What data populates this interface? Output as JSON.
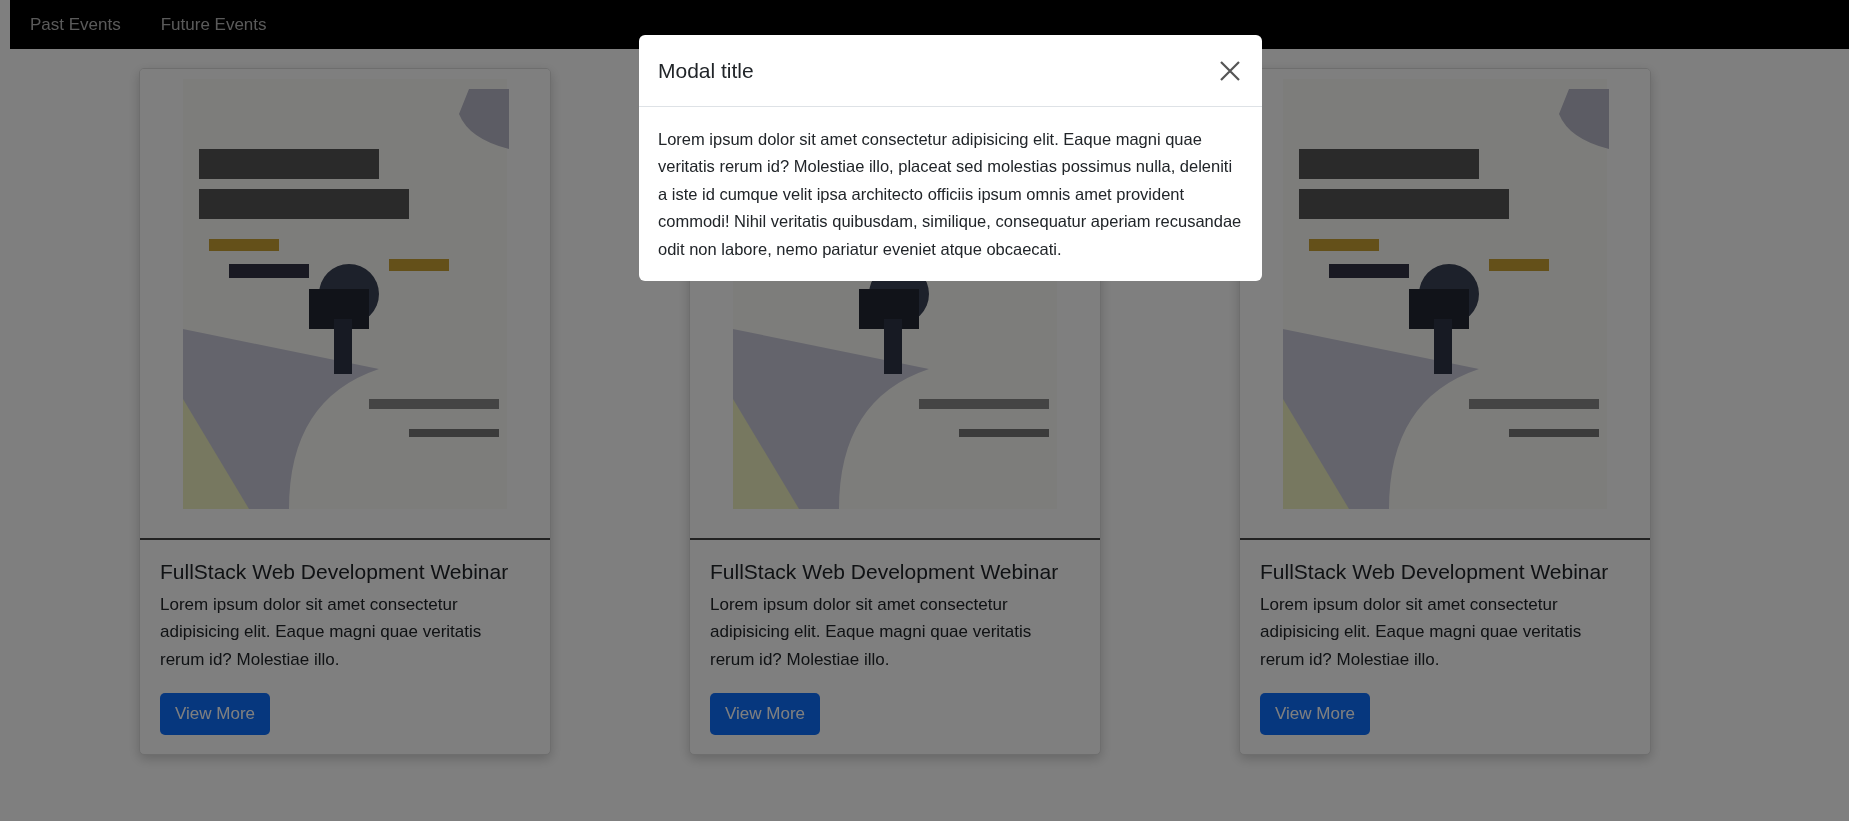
{
  "navbar": {
    "items": [
      {
        "label": "Past Events"
      },
      {
        "label": "Future Events"
      }
    ]
  },
  "cards": [
    {
      "title": "FullStack Web Development Webinar",
      "text": "Lorem ipsum dolor sit amet consectetur adipisicing elit. Eaque magni quae veritatis rerum id? Molestiae illo.",
      "button": "View More"
    },
    {
      "title": "FullStack Web Development Webinar",
      "text": "Lorem ipsum dolor sit amet consectetur adipisicing elit. Eaque magni quae veritatis rerum id? Molestiae illo.",
      "button": "View More"
    },
    {
      "title": "FullStack Web Development Webinar",
      "text": "Lorem ipsum dolor sit amet consectetur adipisicing elit. Eaque magni quae veritatis rerum id? Molestiae illo.",
      "button": "View More"
    }
  ],
  "modal": {
    "title": "Modal title",
    "body": "Lorem ipsum dolor sit amet consectetur adipisicing elit. Eaque magni quae veritatis rerum id? Molestiae illo, placeat sed molestias possimus nulla, deleniti a iste id cumque velit ipsa architecto officiis ipsum omnis amet provident commodi! Nihil veritatis quibusdam, similique, consequatur aperiam recusandae odit non labore, nemo pariatur eveniet atque obcaecati."
  }
}
